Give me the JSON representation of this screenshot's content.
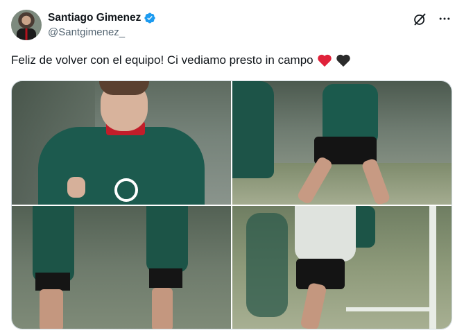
{
  "tweet": {
    "author": {
      "display_name": "Santiago Gimenez",
      "handle": "@Santgimenez_",
      "verified": true,
      "verified_color": "#1d9bf0"
    },
    "text": "Feliz de volver con el equipo! Ci vediamo presto in campo",
    "emojis": [
      "red-heart",
      "black-heart"
    ],
    "icons": {
      "grok": "grok-icon",
      "more": "more-icon"
    },
    "media": [
      {
        "name": "photo-1"
      },
      {
        "name": "photo-2"
      },
      {
        "name": "photo-3"
      },
      {
        "name": "photo-4"
      }
    ]
  }
}
